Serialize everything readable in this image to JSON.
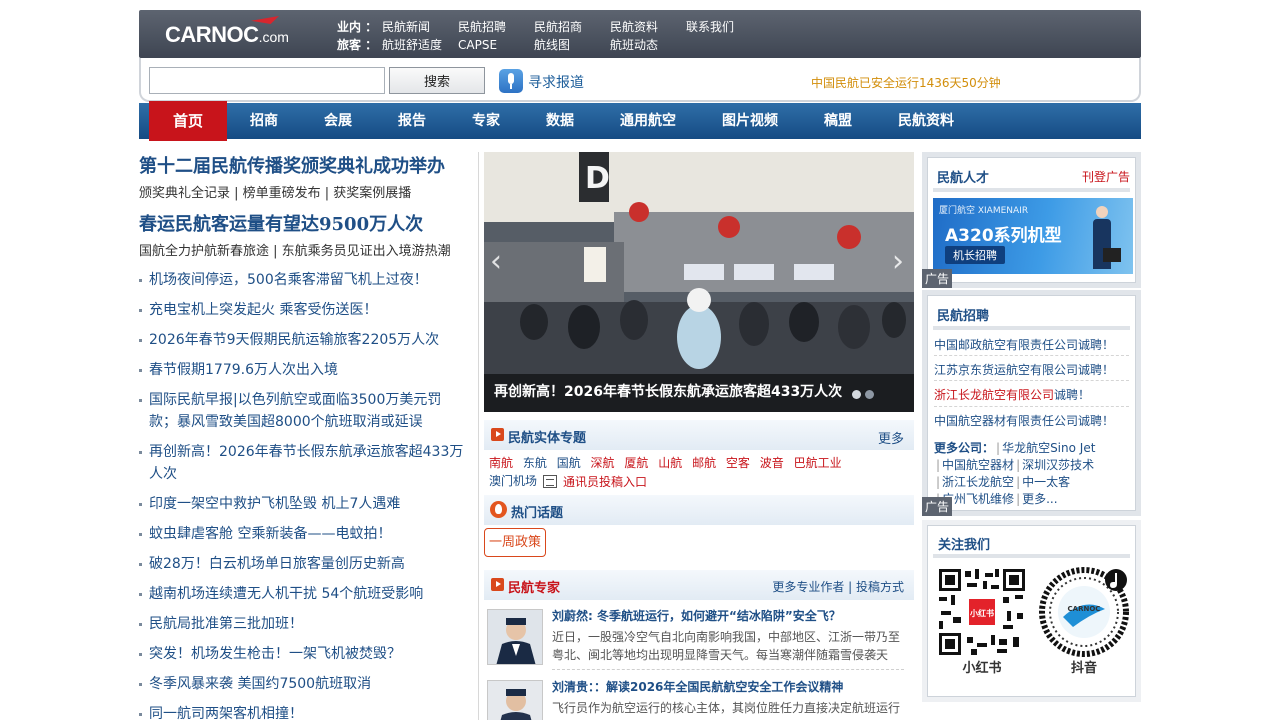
{
  "brand": {
    "logo_main": "CARNOC",
    "logo_suffix": ".com"
  },
  "top_nav": {
    "row1": {
      "label": "业内 ：",
      "links": [
        "民航新闻",
        "民航招聘",
        "民航招商",
        "民航资料",
        "联系我们"
      ]
    },
    "row2": {
      "label": "旅客 ：",
      "links": [
        "航班舒适度",
        "CAPSE",
        "航线图",
        "航班动态"
      ]
    }
  },
  "search": {
    "button": "搜索",
    "seek_report": "寻求报道",
    "safety_text": "中国民航已安全运行1436天50分钟"
  },
  "main_nav": [
    "首页",
    "招商",
    "会展",
    "报告",
    "专家",
    "数据",
    "通用航空",
    "图片视频",
    "稿盟",
    "民航资料"
  ],
  "left": {
    "headline1": "第十二届民航传播奖颁奖典礼成功举办",
    "subline1": "颁奖典礼全记录 | 榜单重磅发布 | 获奖案例展播",
    "headline2": "春运民航客运量有望达9500万人次",
    "subline2": "国航全力护航新春旅途 | 东航乘务员见证出入境游热潮",
    "news": [
      "机场夜间停运，500名乘客滞留飞机上过夜！",
      "充电宝机上突发起火 乘客受伤送医！",
      "2026年春节9天假期民航运输旅客2205万人次",
      "春节假期1779.6万人次出入境",
      "国际民航早报|以色列航空或面临3500万美元罚款；暴风雪致美国超8000个航班取消或延误",
      "再创新高！2026年春节长假东航承运旅客超433万人次",
      "印度一架空中救护飞机坠毁 机上7人遇难",
      "蚊虫肆虐客舱 空乘新装备——电蚊拍！",
      "破28万！白云机场单日旅客量创历史新高",
      "越南机场连续遭无人机干扰 54个航班受影响",
      "民航局批准第三批加班！",
      "突发！机场发生枪击！一架飞机被焚毁？",
      "冬季风暴来袭 美国约7500航班取消",
      "同一航司两架客机相撞！"
    ]
  },
  "slider": {
    "caption": "再创新高！2026年春节长假东航承运旅客超433万人次",
    "sign_letter": "D",
    "active_dot": 0
  },
  "entity": {
    "title": "民航实体专题",
    "more": "更多",
    "links": [
      "南航",
      "东航",
      "国航",
      "深航",
      "厦航",
      "山航",
      "邮航",
      "空客",
      "波音",
      "巴航工业"
    ],
    "macau": "澳门机场",
    "contrib": "通讯员投稿入口"
  },
  "hot": {
    "title": "热门话题",
    "tag": "一周政策"
  },
  "experts": {
    "title": "民航专家",
    "more": "更多专业作者 | 投稿方式",
    "items": [
      {
        "title": "刘蔚然: 冬季航班运行，如何避开“结冰陷阱”安全飞？",
        "desc": "近日，一股强冷空气自北向南影响我国，中部地区、江浙一带乃至粤北、闽北等地均出现明显降雪天气。每当寒潮伴随霜雪侵袭天"
      },
      {
        "title": "刘清贵：：解读2026年全国民航航空安全工作会议精神",
        "desc": "飞行员作为航空运行的核心主体，其岗位胜任力直接决定航班运行"
      }
    ]
  },
  "talent": {
    "title": "民航人才",
    "ad_link": "刊登广告",
    "banner_logo": "厦门航空 XIAMENAIR",
    "banner_title": "A320系列机型",
    "banner_sub": "机长招聘",
    "ad_tag": "广告"
  },
  "jobs": {
    "title": "民航招聘",
    "items": [
      {
        "hl": "",
        "text": "中国邮政航空有限责任公司诚聘！"
      },
      {
        "hl": "",
        "text": "江苏京东货运航空有限公司诚聘！"
      },
      {
        "hl": "浙江长龙航空有限公司",
        "text": "诚聘！"
      },
      {
        "hl": "",
        "text": "中国航空器材有限责任公司诚聘！"
      }
    ],
    "more_label": "更多公司：",
    "companies": [
      [
        "华龙航空Sino Jet"
      ],
      [
        "中国航空器材",
        "深圳汉莎技术"
      ],
      [
        "浙江长龙航空",
        "中一太客"
      ],
      [
        "广州飞机维修",
        "更多..."
      ]
    ],
    "ad_tag": "广告"
  },
  "follow": {
    "title": "关注我们",
    "xhs_label": "小红书",
    "xhs_badge": "小红书",
    "douyin_label": "抖音",
    "douyin_center": "CARNOC"
  },
  "colors": {
    "brand_blue": "#1f4f86",
    "brand_red": "#c8141b",
    "nav_blue": "#154b83",
    "safety_orange": "#d28e0b"
  }
}
